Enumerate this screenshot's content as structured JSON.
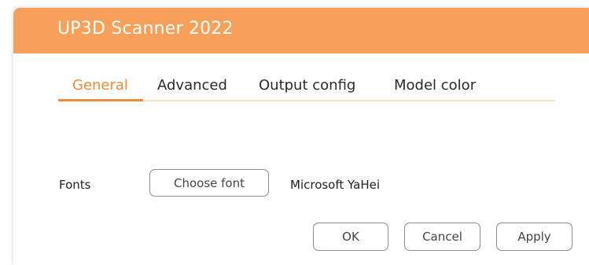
{
  "window": {
    "title": "UP3D Scanner 2022"
  },
  "tabs": [
    {
      "label": "General",
      "active": true
    },
    {
      "label": "Advanced",
      "active": false
    },
    {
      "label": "Output config",
      "active": false
    },
    {
      "label": "Model color",
      "active": false
    }
  ],
  "general": {
    "fonts_label": "Fonts",
    "choose_font_label": "Choose font",
    "current_font": "Microsoft YaHei"
  },
  "footer": {
    "ok_label": "OK",
    "cancel_label": "Cancel",
    "apply_label": "Apply"
  },
  "colors": {
    "titlebar": "#f7a05a",
    "accent": "#f28a3c",
    "tab_rule": "#fde2cb"
  }
}
